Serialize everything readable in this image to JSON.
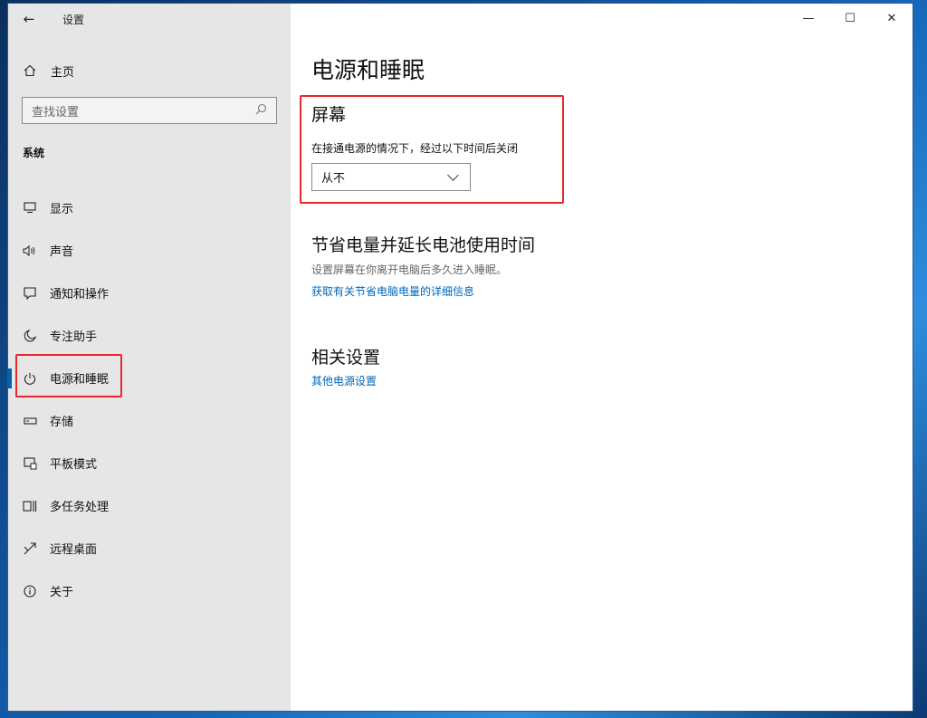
{
  "window": {
    "app_title": "设置",
    "controls": {
      "minimize": "—",
      "maximize": "☐",
      "close": "✕"
    }
  },
  "sidebar": {
    "home_label": "主页",
    "search_placeholder": "查找设置",
    "section_title": "系统",
    "items": [
      {
        "label": "显示",
        "icon": "monitor-icon"
      },
      {
        "label": "声音",
        "icon": "speaker-icon"
      },
      {
        "label": "通知和操作",
        "icon": "notification-icon"
      },
      {
        "label": "专注助手",
        "icon": "moon-icon"
      },
      {
        "label": "电源和睡眠",
        "icon": "power-icon",
        "active": true
      },
      {
        "label": "存储",
        "icon": "storage-icon"
      },
      {
        "label": "平板模式",
        "icon": "tablet-icon"
      },
      {
        "label": "多任务处理",
        "icon": "multitask-icon"
      },
      {
        "label": "远程桌面",
        "icon": "remote-desktop-icon"
      },
      {
        "label": "关于",
        "icon": "info-icon"
      }
    ]
  },
  "main": {
    "page_title": "电源和睡眠",
    "screen": {
      "heading": "屏幕",
      "description": "在接通电源的情况下，经过以下时间后关闭",
      "selected_value": "从不"
    },
    "battery": {
      "heading": "节省电量并延长电池使用时间",
      "description": "设置屏幕在你离开电脑后多久进入睡眠。",
      "link": "获取有关节省电脑电量的详细信息"
    },
    "related": {
      "heading": "相关设置",
      "link": "其他电源设置"
    }
  },
  "colors": {
    "accent": "#0063b1",
    "link": "#0067b8",
    "highlight": "#e8282b",
    "sidebar_bg": "#e6e6e6"
  }
}
